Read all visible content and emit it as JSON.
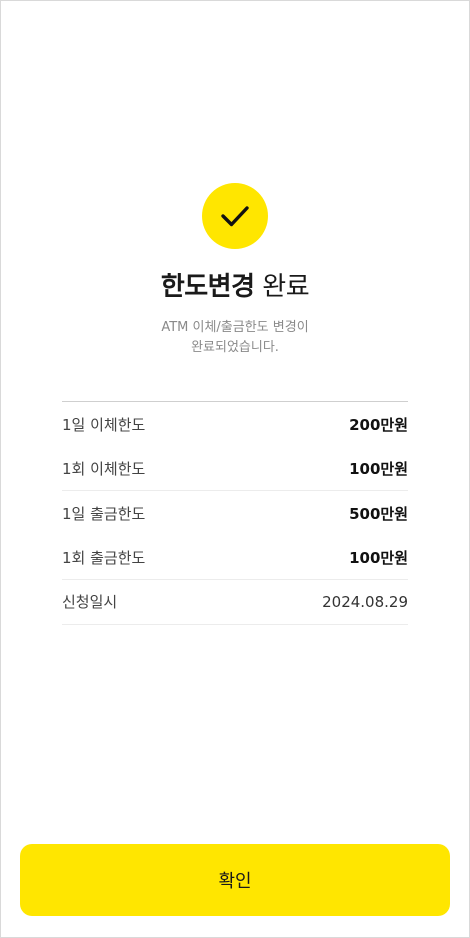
{
  "title": {
    "bold": "한도변경",
    "light": "완료"
  },
  "subtitle": [
    "ATM 이체/출금한도 변경이",
    "완료되었습니다."
  ],
  "rows": [
    {
      "label": "1일 이체한도",
      "value": "200만원"
    },
    {
      "label": "1회 이체한도",
      "value": "100만원"
    },
    {
      "label": "1일 출금한도",
      "value": "500만원"
    },
    {
      "label": "1회 출금한도",
      "value": "100만원"
    },
    {
      "label": "신청일시",
      "value": "2024.08.29"
    }
  ],
  "confirm_label": "확인",
  "icons": {
    "status": "check-icon"
  },
  "colors": {
    "accent": "#ffe600"
  }
}
